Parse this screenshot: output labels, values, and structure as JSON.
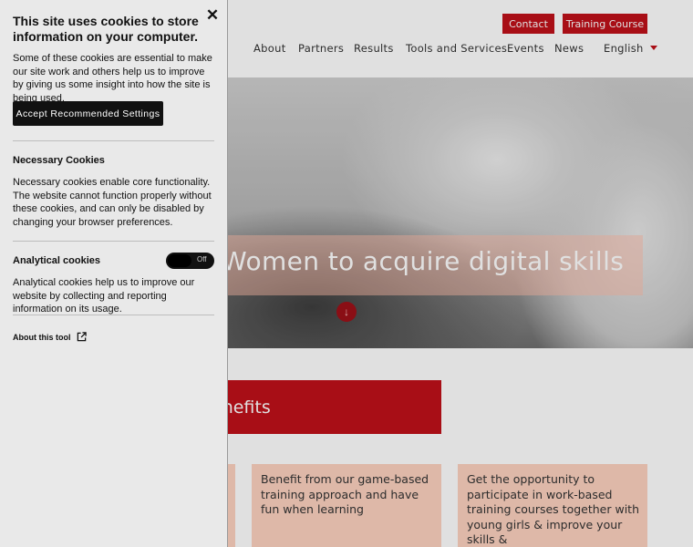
{
  "site": {
    "top_buttons": {
      "contact": "Contact",
      "training": "Training Course"
    },
    "nav": [
      "About",
      "Partners",
      "Results",
      "Tools and Services",
      "Events",
      "News"
    ],
    "language": "English",
    "hero_title": "Women to acquire digital skills",
    "benefits_title": "enefits",
    "cards": [
      "",
      "Benefit from our game-based training approach and have fun when learning",
      "Get the opportunity to participate in work-based training courses together with young girls & improve your skills &"
    ],
    "colors": {
      "brand_red": "#c0101a",
      "card_bg": "#fdd2c0"
    }
  },
  "cookie_panel": {
    "title": "This site uses cookies to store information on your computer.",
    "close_icon": "close-icon",
    "intro": "Some of these cookies are essential to make our site work and others help us to improve by giving us some insight into how the site is being used.",
    "accept_label": "Accept Recommended Settings",
    "necessary": {
      "heading": "Necessary Cookies",
      "text": "Necessary cookies enable core functionality. The website cannot function properly without these cookies, and can only be disabled by changing your browser preferences."
    },
    "analytical": {
      "heading": "Analytical cookies",
      "toggle_state": "Off",
      "text": "Analytical cookies help us to improve our website by collecting and reporting information on its usage."
    },
    "about_link": "About this tool"
  }
}
